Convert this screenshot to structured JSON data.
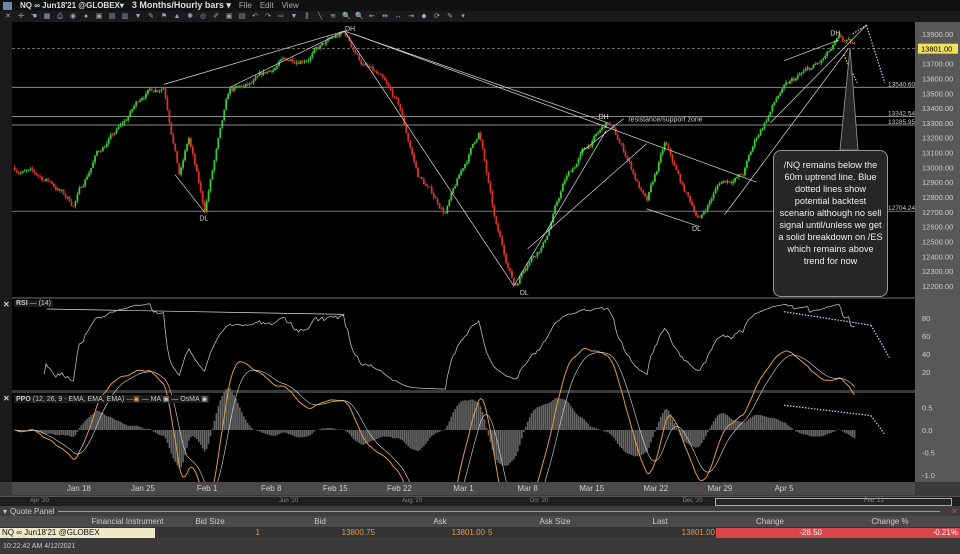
{
  "window": {
    "symbol": "NQ ∞ Jun18'21 @GLOBEX▾",
    "period": "3 Months/Hourly bars ▾",
    "menus": [
      "File",
      "Edit",
      "View"
    ]
  },
  "toolbar": {
    "icons": [
      "cursor-icon",
      "crosshair-icon",
      "hand-icon",
      "grid-icon",
      "print-icon",
      "refresh-icon",
      "circle-icon",
      "image-icon",
      "layout-icon",
      "window-icon",
      "filter-icon",
      "draw-icon",
      "indicator-icon",
      "mountain-icon",
      "gear-icon",
      "target-icon",
      "pencil-icon",
      "save-icon",
      "template-icon",
      "undo-icon",
      "redo-icon",
      "link-icon",
      "triangle-icon",
      "bars-icon",
      "line-icon",
      "fib-icon",
      "zoom-in-icon",
      "zoom-out-icon",
      "shift-left-icon",
      "shift-icon",
      "expand-icon",
      "compress-icon",
      "palette-icon",
      "sync-icon",
      "wrench-icon",
      "dropdown-icon"
    ],
    "glyphs": [
      "✕",
      "✛",
      "☚",
      "▦",
      "⎙",
      "◉",
      "●",
      "▣",
      "▤",
      "▥",
      "▼",
      "✎",
      "⚑",
      "▲",
      "✺",
      "◎",
      "✐",
      "▣",
      "▤",
      "↶",
      "↷",
      "⇨",
      "▼",
      "⫼",
      "╲",
      "≋",
      "🔍",
      "🔍",
      "⇤",
      "⇹",
      "↔",
      "⇥",
      "◆",
      "⟳",
      "✎",
      "▾"
    ]
  },
  "colors": {
    "up": "#39c93a",
    "down": "#d9352b",
    "accent": "#f0e060",
    "neg": "#d9454a",
    "dotted": "#aee0ee",
    "ppo": "#e39a4a"
  },
  "chart_data": [
    {
      "type": "candlestick",
      "title": "NQ Hourly",
      "ylim": [
        12100,
        14020
      ],
      "yticks": [
        13900,
        13800,
        13700,
        13600,
        13500,
        13400,
        13300,
        13200,
        13100,
        13000,
        12900,
        12800,
        12700,
        12600,
        12500,
        12400,
        12300,
        12200
      ],
      "ytick_labels": [
        "13900.00",
        "13800.00",
        "13700.00",
        "13600.00",
        "13500.00",
        "13400.00",
        "13300.00",
        "13200.00",
        "13100.00",
        "13000.00",
        "12900.00",
        "12800.00",
        "12700.00",
        "12600.00",
        "12500.00",
        "12400.00",
        "12300.00",
        "12200.00"
      ],
      "last_price": "13801.00",
      "xlim": [
        -7.3,
        91.3
      ],
      "xticks": [
        0,
        7,
        14,
        21,
        28,
        35,
        42,
        49,
        56,
        63,
        70,
        77
      ],
      "xtick_labels": [
        "Jan 18",
        "Jan 25",
        "Feb 1",
        "Feb 8",
        "Feb 15",
        "Feb 22",
        "Mar 1",
        "Mar 8",
        "Mar 15",
        "Mar 22",
        "Mar 29",
        "Apr 5"
      ],
      "path": [
        [
          -7,
          13000
        ],
        [
          -3,
          12900
        ],
        [
          -0.6,
          12750
        ],
        [
          2,
          13100
        ],
        [
          5,
          13300
        ],
        [
          7,
          13500
        ],
        [
          9.3,
          13560
        ],
        [
          11,
          12950
        ],
        [
          12,
          13200
        ],
        [
          13.7,
          12700
        ],
        [
          15,
          13100
        ],
        [
          16.4,
          13500
        ],
        [
          19,
          13550
        ],
        [
          21.9,
          13700
        ],
        [
          25,
          13760
        ],
        [
          27.5,
          13850
        ],
        [
          29,
          13900
        ],
        [
          31,
          13700
        ],
        [
          32.8,
          13600
        ],
        [
          35,
          13400
        ],
        [
          37,
          12950
        ],
        [
          40,
          12700
        ],
        [
          43.7,
          13250
        ],
        [
          45.5,
          12600
        ],
        [
          47.6,
          12200
        ],
        [
          49,
          12380
        ],
        [
          50.8,
          12500
        ],
        [
          53,
          12900
        ],
        [
          55,
          13100
        ],
        [
          57.8,
          13300
        ],
        [
          60,
          13050
        ],
        [
          62,
          12750
        ],
        [
          64,
          13150
        ],
        [
          66,
          12850
        ],
        [
          67.8,
          12650
        ],
        [
          70,
          12900
        ],
        [
          72.5,
          12950
        ],
        [
          74,
          13200
        ],
        [
          76.5,
          13500
        ],
        [
          78.5,
          13600
        ],
        [
          81,
          13700
        ],
        [
          83.1,
          13850
        ],
        [
          84.7,
          13801
        ]
      ],
      "hlines": [
        {
          "value": 13540.6,
          "label": "13540.60"
        },
        {
          "value": 13342.54,
          "label": "13342.54"
        },
        {
          "value": 13285.95,
          "label": "13285.95"
        },
        {
          "value": 12704.24,
          "label": "12704.24"
        }
      ],
      "zone_label": {
        "text": "resistance/support zone",
        "x": 60,
        "y": 13310
      },
      "trendlines": [
        [
          [
            9.3,
            13560
          ],
          [
            29,
            13920
          ]
        ],
        [
          [
            16.5,
            13540
          ],
          [
            29,
            13920
          ]
        ],
        [
          [
            29,
            13920
          ],
          [
            57.8,
            13300
          ]
        ],
        [
          [
            29,
            13920
          ],
          [
            47.5,
            12200
          ]
        ],
        [
          [
            30,
            13900
          ],
          [
            74,
            12900
          ]
        ],
        [
          [
            47.5,
            12200
          ],
          [
            57.6,
            13250
          ]
        ],
        [
          [
            54.8,
            13100
          ],
          [
            59.5,
            13330
          ]
        ],
        [
          [
            49,
            12450
          ],
          [
            62,
            13160
          ]
        ],
        [
          [
            10.5,
            12950
          ],
          [
            13.7,
            12700
          ]
        ],
        [
          [
            62,
            12720
          ],
          [
            67.8,
            12600
          ]
        ],
        [
          [
            70.5,
            12680
          ],
          [
            84,
            13800
          ]
        ],
        [
          [
            77,
            13720
          ],
          [
            83,
            13860
          ]
        ],
        [
          [
            75.5,
            13300
          ],
          [
            86,
            13960
          ]
        ]
      ],
      "dotted": [
        [
          [
            84.5,
            13900
          ],
          [
            86,
            13960
          ]
        ],
        [
          [
            86,
            13960
          ],
          [
            88,
            13570
          ]
        ],
        [
          [
            83.5,
            13760
          ],
          [
            85,
            13570
          ]
        ]
      ],
      "labels": [
        {
          "text": "DH",
          "x": 29.6,
          "y": 13920
        },
        {
          "text": "DL",
          "x": 13.7,
          "y": 12640
        },
        {
          "text": "DL",
          "x": 48.7,
          "y": 12140
        },
        {
          "text": "DH",
          "x": 57.3,
          "y": 13325
        },
        {
          "text": "DL",
          "x": 67.5,
          "y": 12570
        },
        {
          "text": "DH",
          "x": 82.6,
          "y": 13890
        }
      ]
    },
    {
      "type": "line",
      "title": "RSI",
      "params": "(14)",
      "ylim": [
        0,
        100
      ],
      "yticks": [
        80,
        60,
        40,
        20
      ],
      "ytick_labels": [
        "80",
        "60",
        "40",
        "20"
      ]
    },
    {
      "type": "line",
      "title": "PPO",
      "params": "(12, 26, 9 - EMA, EMA, EMA)",
      "legend": [
        "MA",
        "OsMA"
      ],
      "ylim": [
        -1.1,
        0.65
      ],
      "yticks": [
        0.5,
        0,
        -0.5,
        -1
      ],
      "ytick_labels": [
        "0.5",
        "0.0",
        "-0.5",
        "-1.0"
      ]
    }
  ],
  "callout": {
    "text": "/NQ remains below the 60m uptrend line. Blue dotted lines show potential backtest scenario although no sell signal until/unless we get a solid breakdown on /ES which remains above trend for now"
  },
  "scroll": {
    "labels": [
      "Apr '20",
      "Jun '20",
      "Aug '20",
      "Oct '20",
      "Dec '20",
      "Feb '21"
    ]
  },
  "quote_panel": {
    "title": "Quote Panel",
    "columns": [
      "Financial Instrument",
      "Bid Size",
      "Bid",
      "Ask",
      "Ask Size",
      "Last",
      "Change",
      "Change %"
    ],
    "row": {
      "instrument": "NQ ∞ Jun18'21 @GLOBEX",
      "bid_size": "1",
      "bid": "13800.75",
      "ask": "13801.00",
      "ask_size": "5",
      "last": "13801.00",
      "change": "-28.50",
      "change_pct": "-0.21%"
    }
  },
  "status": {
    "time": "10:22:42 AM 4/12/2021"
  }
}
